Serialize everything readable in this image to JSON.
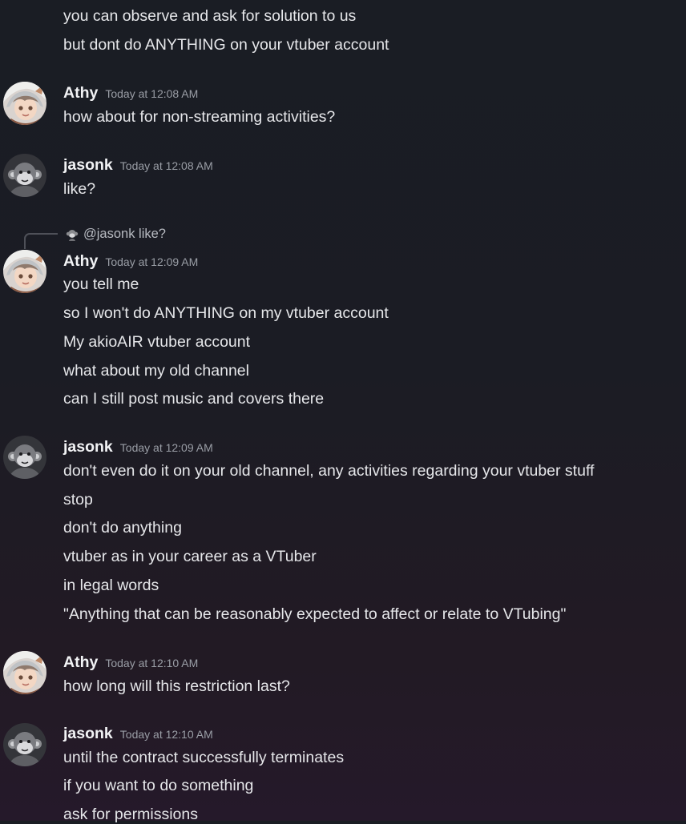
{
  "colors": {
    "background_top": "#1a1d24",
    "background_bottom": "#25192a",
    "text": "#e6e7ea",
    "timestamp": "#9a9ea6"
  },
  "messages": [
    {
      "lines": [
        "you can observe and ask for solution to us",
        "but dont do ANYTHING on your vtuber account"
      ]
    },
    {
      "author": "Athy",
      "avatar_icon": "anime-character-avatar-icon",
      "timestamp": "Today at 12:08 AM",
      "lines": [
        "how about for non-streaming activities?"
      ]
    },
    {
      "author": "jasonk",
      "avatar_icon": "monkey-avatar-icon",
      "timestamp": "Today at 12:08 AM",
      "lines": [
        "like?"
      ]
    },
    {
      "reply_to": "@jasonk like?",
      "author": "Athy",
      "avatar_icon": "anime-character-avatar-icon",
      "timestamp": "Today at 12:09 AM",
      "lines": [
        "you tell me",
        "so I won't do ANYTHING on my vtuber account",
        "My akioAIR vtuber account",
        "what about my old channel",
        "can I still post music and covers there"
      ]
    },
    {
      "author": "jasonk",
      "avatar_icon": "monkey-avatar-icon",
      "timestamp": "Today at 12:09 AM",
      "lines": [
        "don't even do it on your old channel, any activities regarding your vtuber stuff",
        "stop",
        "don't do anything",
        "vtuber as in your career as a VTuber",
        "in legal words",
        "\"Anything that can be reasonably expected to affect or relate to VTubing\""
      ]
    },
    {
      "author": "Athy",
      "avatar_icon": "anime-character-avatar-icon",
      "timestamp": "Today at 12:10 AM",
      "lines": [
        "how long will this restriction last?"
      ]
    },
    {
      "author": "jasonk",
      "avatar_icon": "monkey-avatar-icon",
      "timestamp": "Today at 12:10 AM",
      "lines": [
        "until the contract successfully terminates",
        "if you want to do something",
        "ask for permissions"
      ]
    }
  ]
}
